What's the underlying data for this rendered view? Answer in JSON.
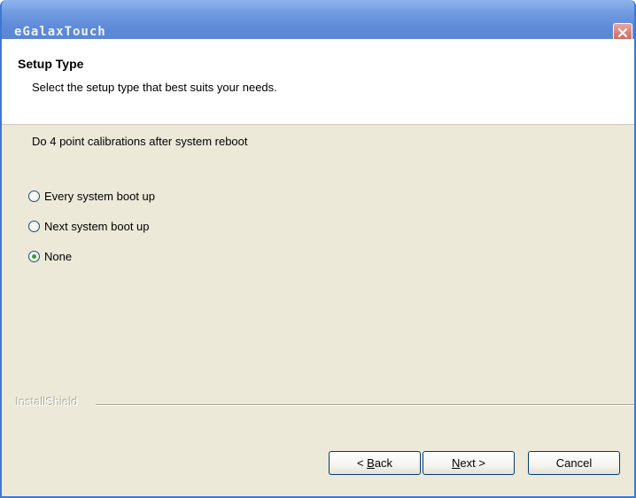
{
  "window": {
    "title": "eGalaxTouch"
  },
  "header": {
    "title": "Setup Type",
    "subtitle": "Select the setup type that best suits your needs."
  },
  "main": {
    "prompt": "Do 4 point calibrations after system reboot",
    "options": [
      {
        "label": "Every system boot up",
        "selected": false
      },
      {
        "label": "Next system boot up",
        "selected": false
      },
      {
        "label": "None",
        "selected": true
      }
    ]
  },
  "footer": {
    "brand": "InstallShield",
    "back_prefix": "< ",
    "back_mnemonic": "B",
    "back_rest": "ack",
    "next_mnemonic": "N",
    "next_rest": "ext >",
    "cancel_label": "Cancel"
  },
  "icons": {
    "close": "close-icon"
  },
  "colors": {
    "titlebar": "#5e8ad8",
    "close_button": "#d97a70",
    "dialog_background": "#ece9d8",
    "radio_selected_dot": "#2fa326"
  }
}
